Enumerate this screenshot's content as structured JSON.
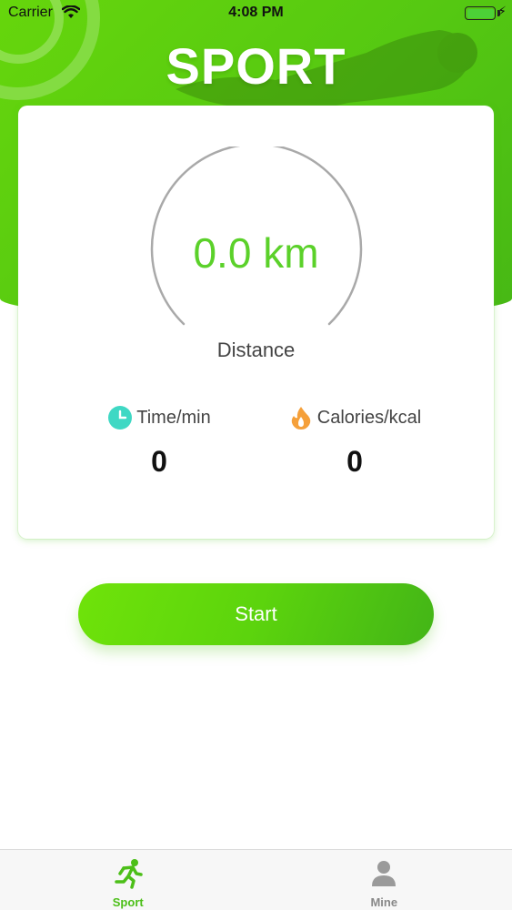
{
  "status_bar": {
    "carrier": "Carrier",
    "time": "4:08 PM"
  },
  "header": {
    "title": "SPORT"
  },
  "card": {
    "distance_value": "0.0 km",
    "distance_label": "Distance",
    "stats": {
      "time": {
        "label": "Time/min",
        "value": "0",
        "icon": "clock-icon"
      },
      "calories": {
        "label": "Calories/kcal",
        "value": "0",
        "icon": "flame-icon"
      }
    }
  },
  "start_button": {
    "label": "Start"
  },
  "tab_bar": {
    "tabs": [
      {
        "label": "Sport",
        "icon": "running-person-icon",
        "active": true
      },
      {
        "label": "Mine",
        "icon": "person-icon",
        "active": false
      }
    ]
  },
  "colors": {
    "brand_green": "#5bd12a",
    "tab_active": "#4cbf18",
    "tab_inactive": "#888888"
  }
}
